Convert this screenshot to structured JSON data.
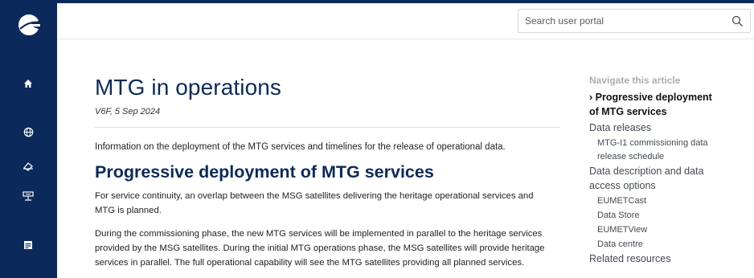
{
  "search": {
    "placeholder": "Search user portal"
  },
  "sidebar": {
    "icons": [
      "home-icon",
      "globe-icon",
      "layers-icon",
      "monitor-icon",
      "calendar-icon"
    ]
  },
  "article": {
    "title": "MTG in operations",
    "meta": "V6F, 5 Sep 2024",
    "intro": "Information on the deployment of the MTG services and timelines for the release of operational data.",
    "section_heading": "Progressive deployment of MTG services",
    "paragraph1": [
      "For service continuity, an overlap between the MSG satellites delivering the heritage operational services and",
      "MTG is planned."
    ],
    "paragraph2": [
      "During the commissioning phase, the new MTG services will be implemented in parallel to the heritage services",
      "provided by the MSG satellites. During the initial MTG operations phase, the MSG satellites will provide heritage",
      "services in parallel. The full operational capability will see the MTG satellites providing all planned services."
    ]
  },
  "toc": {
    "heading": "Navigate this article",
    "active_line1": "› Progressive deployment",
    "active_line2": "of MTG services",
    "data_releases": "Data releases",
    "sub_commissioning_line1": "MTG-I1 commissioning data",
    "sub_commissioning_line2": "release schedule",
    "access_line1": "Data description and data",
    "access_line2": "access options",
    "sub_eumetcast": "EUMETCast",
    "sub_datastore": "Data Store",
    "sub_eumetview": "EUMETView",
    "sub_datacentre": "Data centre",
    "related": "Related resources"
  },
  "colors": {
    "brand": "#0b2a5b",
    "heading": "#0b2a5b",
    "toc_heading": "#a9adb3"
  }
}
